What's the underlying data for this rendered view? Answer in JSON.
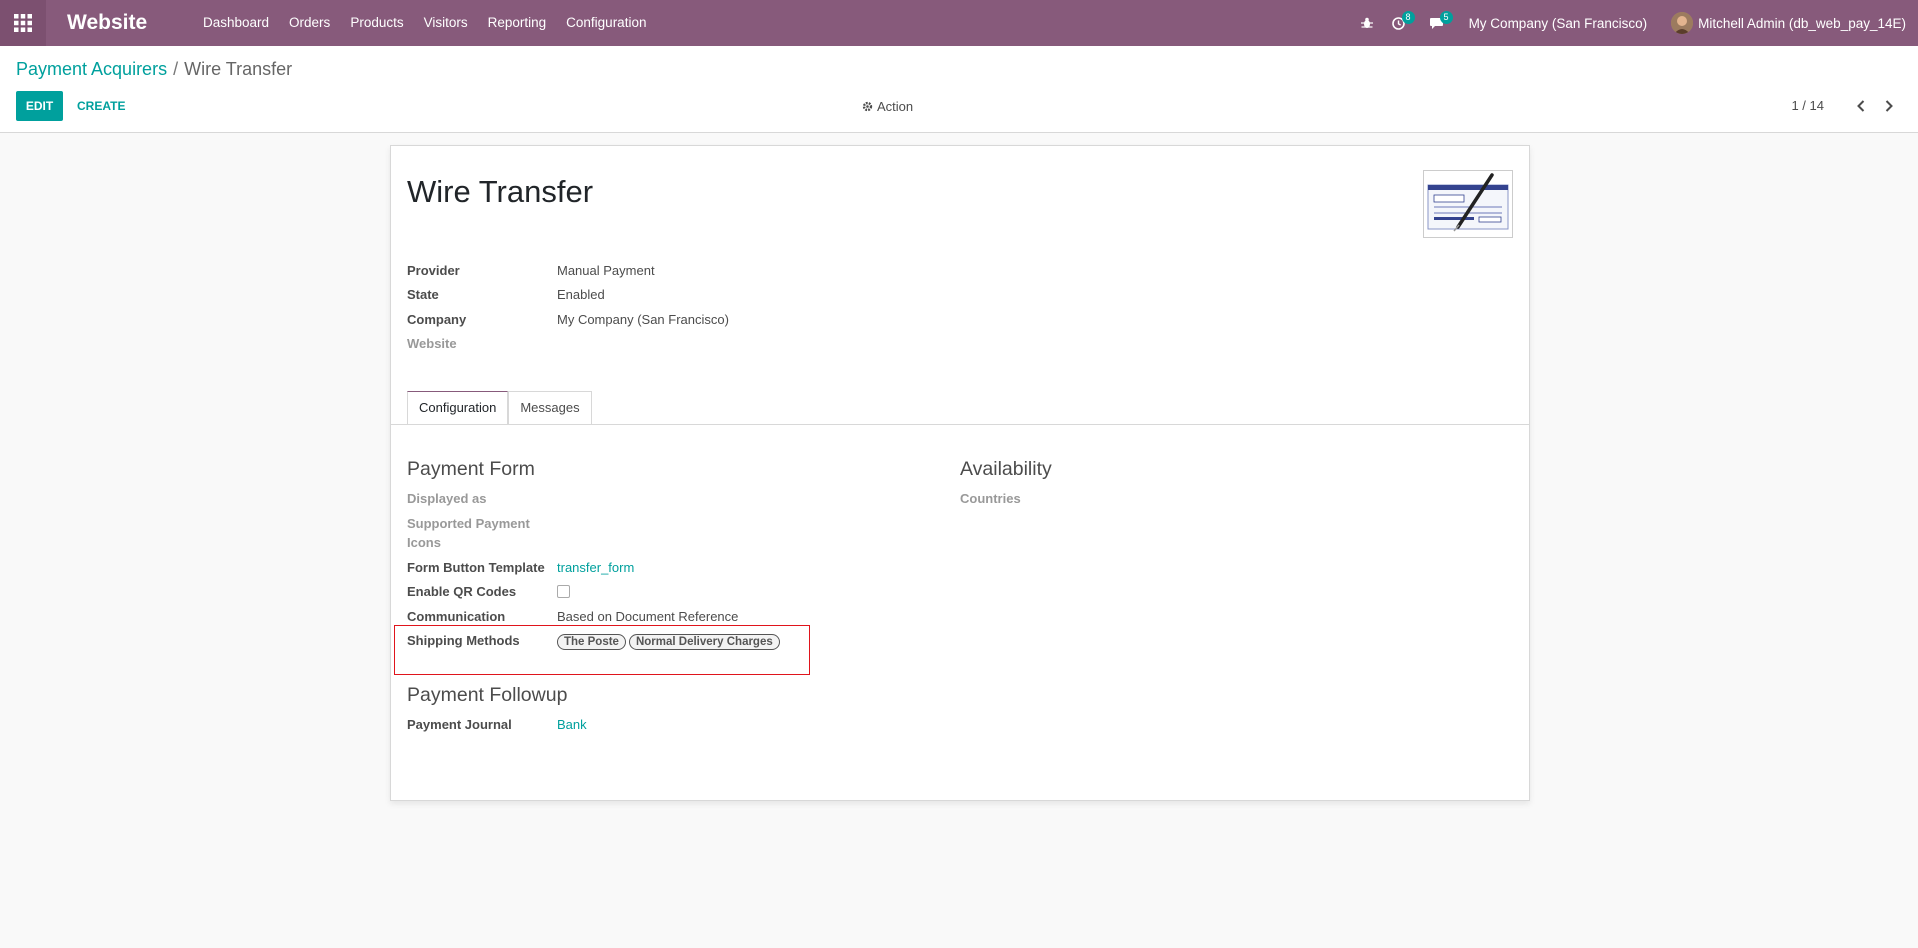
{
  "navbar": {
    "brand": "Website",
    "menu": [
      "Dashboard",
      "Orders",
      "Products",
      "Visitors",
      "Reporting",
      "Configuration"
    ],
    "activities_count": "8",
    "messages_count": "5",
    "company": "My Company (San Francisco)",
    "user": "Mitchell Admin (db_web_pay_14E)"
  },
  "breadcrumb": {
    "parent": "Payment Acquirers",
    "separator": "/",
    "current": "Wire Transfer"
  },
  "toolbar": {
    "edit_label": "EDIT",
    "create_label": "CREATE",
    "action_label": "Action"
  },
  "pager": {
    "value": "1 / 14"
  },
  "record": {
    "title": "Wire Transfer",
    "fields": [
      {
        "label": "Provider",
        "value": "Manual Payment"
      },
      {
        "label": "State",
        "value": "Enabled"
      },
      {
        "label": "Company",
        "value": "My Company (San Francisco)"
      },
      {
        "label": "Website",
        "value": ""
      }
    ]
  },
  "tabs": [
    "Configuration",
    "Messages"
  ],
  "payment_form": {
    "title": "Payment Form",
    "displayed_as": "Displayed as",
    "supported_icons_line1": "Supported Payment",
    "supported_icons_line2": "Icons",
    "form_button_template_label": "Form Button Template",
    "form_button_template_value": "transfer_form",
    "enable_qr_label": "Enable QR Codes",
    "enable_qr_checked": false,
    "communication_label": "Communication",
    "communication_value": "Based on Document Reference",
    "shipping_methods_label": "Shipping Methods",
    "shipping_methods": [
      "The Poste",
      "Normal Delivery Charges"
    ]
  },
  "availability": {
    "title": "Availability",
    "countries_label": "Countries"
  },
  "payment_followup": {
    "title": "Payment Followup",
    "journal_label": "Payment Journal",
    "journal_value": "Bank"
  },
  "colors": {
    "brand": "#875a7b",
    "accent": "#00a09d",
    "highlight": "#e0141c"
  }
}
